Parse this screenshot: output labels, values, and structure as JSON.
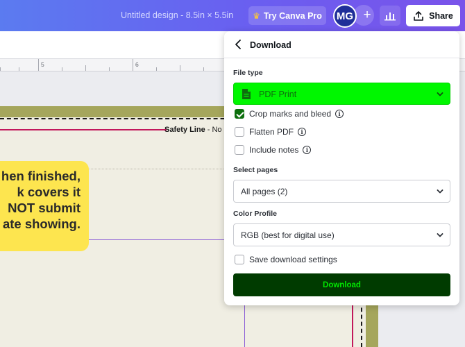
{
  "topbar": {
    "doc_title": "Untitled design - 8.5in × 5.5in",
    "try_pro_label": "Try Canva Pro",
    "crown_icon": "crown-icon",
    "avatar_initials": "MG",
    "add_label": "+",
    "share_label": "Share"
  },
  "ruler": {
    "marks": [
      "5",
      "6"
    ]
  },
  "canvas": {
    "safety_label_bold": "Safety Line",
    "safety_label_rest": " - No",
    "note_lines": [
      "hen finished,",
      "k covers it",
      "NOT submit",
      "ate showing."
    ]
  },
  "panel": {
    "title": "Download",
    "file_type_label": "File type",
    "file_type_value": "PDF Print",
    "options": [
      {
        "label": "Crop marks and bleed",
        "checked": true,
        "info": true
      },
      {
        "label": "Flatten PDF",
        "checked": false,
        "info": true
      },
      {
        "label": "Include notes",
        "checked": false,
        "info": true
      }
    ],
    "select_pages_label": "Select pages",
    "select_pages_value": "All pages (2)",
    "color_profile_label": "Color Profile",
    "color_profile_value": "RGB (best for digital use)",
    "save_settings_label": "Save download settings",
    "save_settings_checked": false,
    "download_label": "Download"
  },
  "colors": {
    "topbar_start": "#5b7bf0",
    "topbar_end": "#7a53ea",
    "file_type_bg": "#00f700",
    "download_bg": "#003b00",
    "download_text": "#00e600",
    "checkbox_checked": "#0d6f0d",
    "bleed": "#a5a65c",
    "safety_line": "#c2185b",
    "note_bg": "#fde54f"
  }
}
